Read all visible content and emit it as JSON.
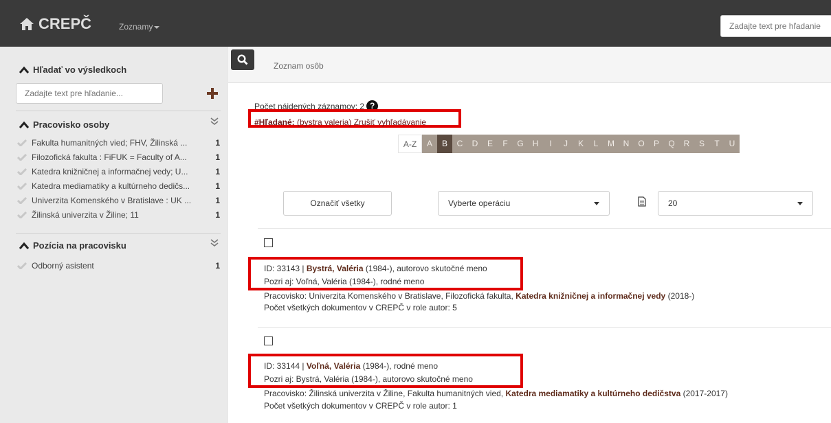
{
  "nav": {
    "brand": "CREPČ",
    "menu": "Zoznamy",
    "search_placeholder": "Zadajte text pre hľadanie"
  },
  "sidebar": {
    "search_title": "Hľadať vo výsledkoch",
    "search_placeholder": "Zadajte text pre hľadanie...",
    "sections": [
      {
        "title": "Pracovisko osoby",
        "items": [
          {
            "label": "Fakulta humanitných vied; FHV, Žilinská ...",
            "count": "1"
          },
          {
            "label": "Filozofická fakulta : FiFUK = Faculty of A...",
            "count": "1"
          },
          {
            "label": "Katedra knižničnej a informačnej vedy; U...",
            "count": "1"
          },
          {
            "label": "Katedra mediamatiky a kultúrneho dedičs...",
            "count": "1"
          },
          {
            "label": "Univerzita Komenského v Bratislave : UK ...",
            "count": "1"
          },
          {
            "label": "Žilinská univerzita v Žiline; 11",
            "count": "1"
          }
        ]
      },
      {
        "title": "Pozícia na pracovisku",
        "items": [
          {
            "label": "Odborný asistent",
            "count": "1"
          }
        ]
      }
    ]
  },
  "main": {
    "title": "Zoznam osôb",
    "count_text": "Počet nájdených záznamov: 2",
    "search_label": "#Hľadané:",
    "search_query": "(bystra valeria)",
    "search_cancel": "Zrušiť vyhľadávanie",
    "alphabet": [
      "A-Z",
      "A",
      "B",
      "C",
      "D",
      "E",
      "F",
      "G",
      "H",
      "I",
      "J",
      "K",
      "L",
      "M",
      "N",
      "O",
      "P",
      "Q",
      "R",
      "S",
      "T",
      "U"
    ],
    "alphabet_active": "B",
    "mark_all": "Označiť všetky",
    "operation_select": "Vyberte operáciu",
    "page_size": "20"
  },
  "records": [
    {
      "id_prefix": "ID: 33143 | ",
      "name": "Bystrá, Valéria",
      "name_suffix": " (1984-), autorovo skutočné meno",
      "see_also": "Pozri aj: Voľná, Valéria (1984-), rodné meno",
      "workplace_prefix": "Pracovisko: Univerzita Komenského v Bratislave, Filozofická fakulta, ",
      "workplace_bold": "Katedra knižničnej a informačnej vedy",
      "workplace_suffix": " (2018-)",
      "docs": "Počet všetkých dokumentov v CREPČ v role autor: 5"
    },
    {
      "id_prefix": "ID: 33144 | ",
      "name": "Voľná, Valéria",
      "name_suffix": " (1984-), rodné meno",
      "see_also": "Pozri aj: Bystrá, Valéria (1984-), autorovo skutočné meno",
      "workplace_prefix": "Pracovisko: Žilinská univerzita v Žiline, Fakulta humanitných vied, ",
      "workplace_bold": "Katedra mediamatiky a kultúrneho dedičstva",
      "workplace_suffix": " (2017-2017)",
      "docs": "Počet všetkých dokumentov v CREPČ v role autor: 1"
    }
  ],
  "colors": {
    "navbar": "#3a3a3a",
    "highlight": "#e00000",
    "accent_brown": "#5e2b1b",
    "alpha_bg": "#a59a8f"
  }
}
